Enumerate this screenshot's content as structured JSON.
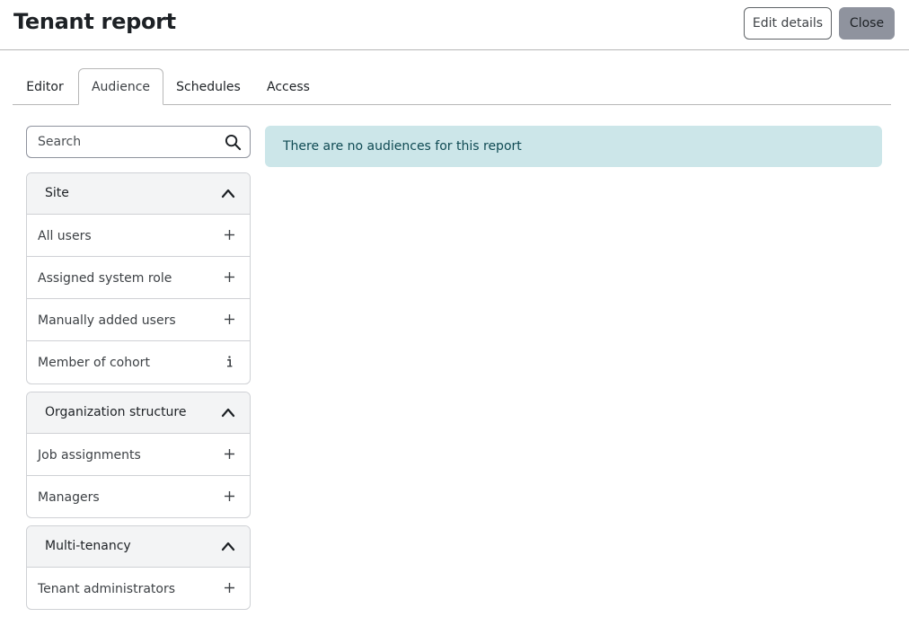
{
  "header": {
    "title": "Tenant report",
    "edit_label": "Edit details",
    "close_label": "Close"
  },
  "tabs": [
    {
      "label": "Editor",
      "active": false
    },
    {
      "label": "Audience",
      "active": true
    },
    {
      "label": "Schedules",
      "active": false
    },
    {
      "label": "Access",
      "active": false
    }
  ],
  "search": {
    "placeholder": "Search",
    "value": "",
    "icon": "search-icon"
  },
  "groups": [
    {
      "title": "Site",
      "expanded": true,
      "items": [
        {
          "label": "All users",
          "icon": "plus-icon"
        },
        {
          "label": "Assigned system role",
          "icon": "plus-icon"
        },
        {
          "label": "Manually added users",
          "icon": "plus-icon"
        },
        {
          "label": "Member of cohort",
          "icon": "info-icon"
        }
      ]
    },
    {
      "title": "Organization structure",
      "expanded": true,
      "items": [
        {
          "label": "Job assignments",
          "icon": "plus-icon"
        },
        {
          "label": "Managers",
          "icon": "plus-icon"
        }
      ]
    },
    {
      "title": "Multi-tenancy",
      "expanded": true,
      "items": [
        {
          "label": "Tenant administrators",
          "icon": "plus-icon"
        }
      ]
    }
  ],
  "alert": {
    "message": "There are no audiences for this report"
  },
  "colors": {
    "alert_bg": "#cce6e9",
    "alert_text": "#0f4a53",
    "close_button_bg": "#8f939e",
    "group_header_bg": "#f3f4f5",
    "border": "#cfd1d5"
  }
}
